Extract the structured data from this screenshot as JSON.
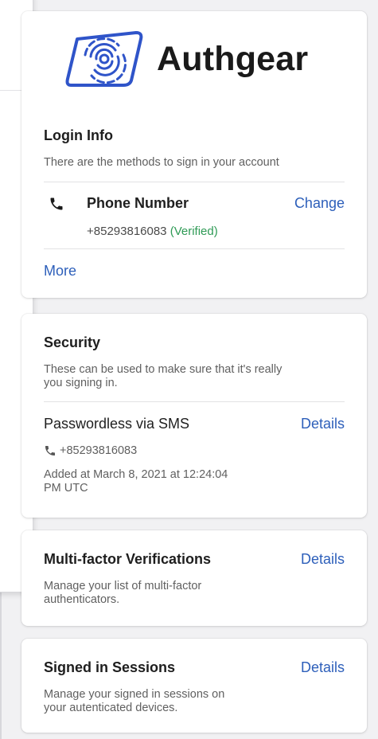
{
  "brand": {
    "name": "Authgear",
    "logo_icon": "fingerprint-icon"
  },
  "login": {
    "title": "Login Info",
    "description": "There are the methods to sign in your account",
    "method": {
      "label": "Phone Number",
      "value": "+85293816083",
      "status": "(Verified)",
      "action": "Change",
      "icon": "phone-icon"
    },
    "more": "More"
  },
  "security": {
    "title": "Security",
    "description_line1": "These can be used to make sure that it's really",
    "description_line2": "you signing in.",
    "method": {
      "label": "Passwordless via SMS",
      "action": "Details",
      "phone": "+85293816083",
      "added_line1": "Added at March 8, 2021 at 12:24:04",
      "added_line2": "PM UTC"
    }
  },
  "mfa": {
    "title": "Multi-factor Verifications",
    "action": "Details",
    "description_line1": "Manage your list of multi-factor",
    "description_line2": "authenticators."
  },
  "sessions": {
    "title": "Signed in Sessions",
    "action": "Details",
    "description_line1": "Manage your signed in sessions on",
    "description_line2": "your autenticated devices."
  },
  "colors": {
    "link": "#2d5fba",
    "verified": "#2e9a55",
    "brand_icon": "#2f54c9"
  }
}
